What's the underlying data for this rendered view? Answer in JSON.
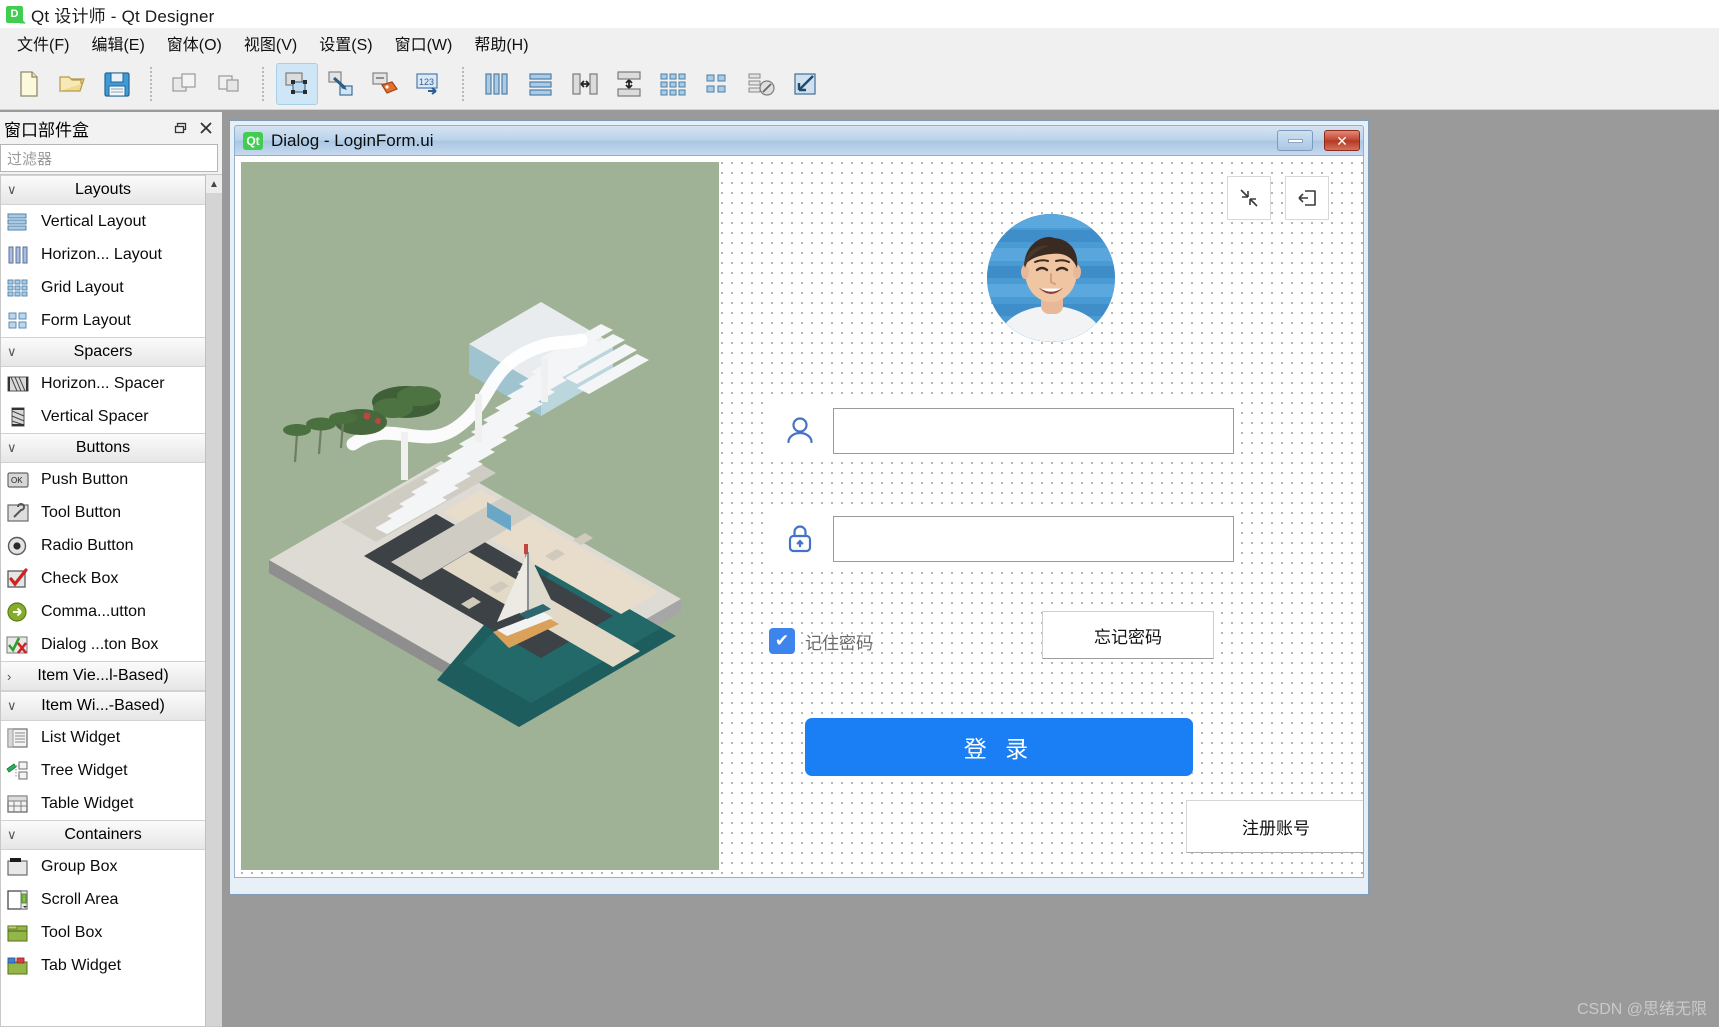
{
  "window": {
    "title": "Qt 设计师 - Qt Designer",
    "logo_text": "D"
  },
  "menubar": {
    "items": [
      {
        "label": "文件(F)",
        "name": "menu-file"
      },
      {
        "label": "编辑(E)",
        "name": "menu-edit"
      },
      {
        "label": "窗体(O)",
        "name": "menu-form"
      },
      {
        "label": "视图(V)",
        "name": "menu-view"
      },
      {
        "label": "设置(S)",
        "name": "menu-settings"
      },
      {
        "label": "窗口(W)",
        "name": "menu-window"
      },
      {
        "label": "帮助(H)",
        "name": "menu-help"
      }
    ]
  },
  "toolbar": {
    "buttons": [
      {
        "icon": "new-file-icon",
        "active": false
      },
      {
        "icon": "open-folder-icon",
        "active": false
      },
      {
        "icon": "save-icon",
        "active": false
      },
      {
        "icon": "separator",
        "active": false
      },
      {
        "icon": "undo-icon",
        "active": false
      },
      {
        "icon": "redo-icon",
        "active": false
      },
      {
        "icon": "separator",
        "active": false
      },
      {
        "icon": "edit-widgets-icon",
        "active": true
      },
      {
        "icon": "edit-signals-slots-icon",
        "active": false
      },
      {
        "icon": "edit-buddies-icon",
        "active": false
      },
      {
        "icon": "edit-tab-order-icon",
        "active": false
      },
      {
        "icon": "separator",
        "active": false
      },
      {
        "icon": "layout-horizontal-icon",
        "active": false
      },
      {
        "icon": "layout-vertical-icon",
        "active": false
      },
      {
        "icon": "layout-splitter-horizontal-icon",
        "active": false
      },
      {
        "icon": "layout-splitter-vertical-icon",
        "active": false
      },
      {
        "icon": "layout-grid-icon",
        "active": false
      },
      {
        "icon": "layout-form-icon",
        "active": false
      },
      {
        "icon": "break-layout-icon",
        "active": false
      },
      {
        "icon": "adjust-size-icon",
        "active": false
      }
    ]
  },
  "widget_box": {
    "title": "窗口部件盒",
    "float_icon": "restore-icon",
    "close_icon": "close-icon",
    "filter_placeholder": "过滤器",
    "filter_value": "",
    "groups": [
      {
        "label": "Layouts",
        "expanded": true,
        "items": [
          {
            "label": "Vertical Layout",
            "icon": "vertical-layout-icon"
          },
          {
            "label": "Horizon... Layout",
            "icon": "horizontal-layout-icon"
          },
          {
            "label": "Grid Layout",
            "icon": "grid-layout-icon"
          },
          {
            "label": "Form Layout",
            "icon": "form-layout-icon"
          }
        ]
      },
      {
        "label": "Spacers",
        "expanded": true,
        "items": [
          {
            "label": "Horizon... Spacer",
            "icon": "horizontal-spacer-icon"
          },
          {
            "label": "Vertical Spacer",
            "icon": "vertical-spacer-icon"
          }
        ]
      },
      {
        "label": "Buttons",
        "expanded": true,
        "items": [
          {
            "label": "Push Button",
            "icon": "push-button-icon"
          },
          {
            "label": "Tool Button",
            "icon": "tool-button-icon"
          },
          {
            "label": "Radio Button",
            "icon": "radio-button-icon"
          },
          {
            "label": "Check Box",
            "icon": "check-box-icon"
          },
          {
            "label": "Comma...utton",
            "icon": "command-link-button-icon"
          },
          {
            "label": "Dialog ...ton Box",
            "icon": "dialog-button-box-icon"
          }
        ]
      },
      {
        "label": "Item Vie...l-Based)",
        "expanded": false,
        "items": []
      },
      {
        "label": "Item Wi...-Based)",
        "expanded": true,
        "items": [
          {
            "label": "List Widget",
            "icon": "list-widget-icon"
          },
          {
            "label": "Tree Widget",
            "icon": "tree-widget-icon"
          },
          {
            "label": "Table Widget",
            "icon": "table-widget-icon"
          }
        ]
      },
      {
        "label": "Containers",
        "expanded": true,
        "items": [
          {
            "label": "Group Box",
            "icon": "group-box-icon"
          },
          {
            "label": "Scroll Area",
            "icon": "scroll-area-icon"
          },
          {
            "label": "Tool Box",
            "icon": "tool-box-icon"
          },
          {
            "label": "Tab Widget",
            "icon": "tab-widget-icon"
          }
        ]
      }
    ]
  },
  "dialog": {
    "logo_text": "Qt",
    "title": "Dialog - LoginForm.ui",
    "minimize_label": "",
    "close_label": "✕"
  },
  "login_form": {
    "collapse_icon": "collapse-arrows-icon",
    "exit_icon": "exit-door-icon",
    "avatar_name": "user-avatar",
    "username": {
      "icon": "user-icon",
      "value": "",
      "placeholder": ""
    },
    "password": {
      "icon": "lock-icon",
      "value": "",
      "placeholder": ""
    },
    "remember": {
      "label": "记住密码",
      "checked": true,
      "check_glyph": "✔"
    },
    "forgot_password_label": "忘记密码",
    "login_label": "登 录",
    "register_label": "注册账号"
  },
  "watermark": "CSDN @思绪无限",
  "colors": {
    "accent_blue": "#1a7ef5",
    "checkbox_blue": "#3d85ec",
    "icon_blue": "#4472c4",
    "illustration_bg": "#9fb296",
    "qt_green": "#41cd52"
  }
}
